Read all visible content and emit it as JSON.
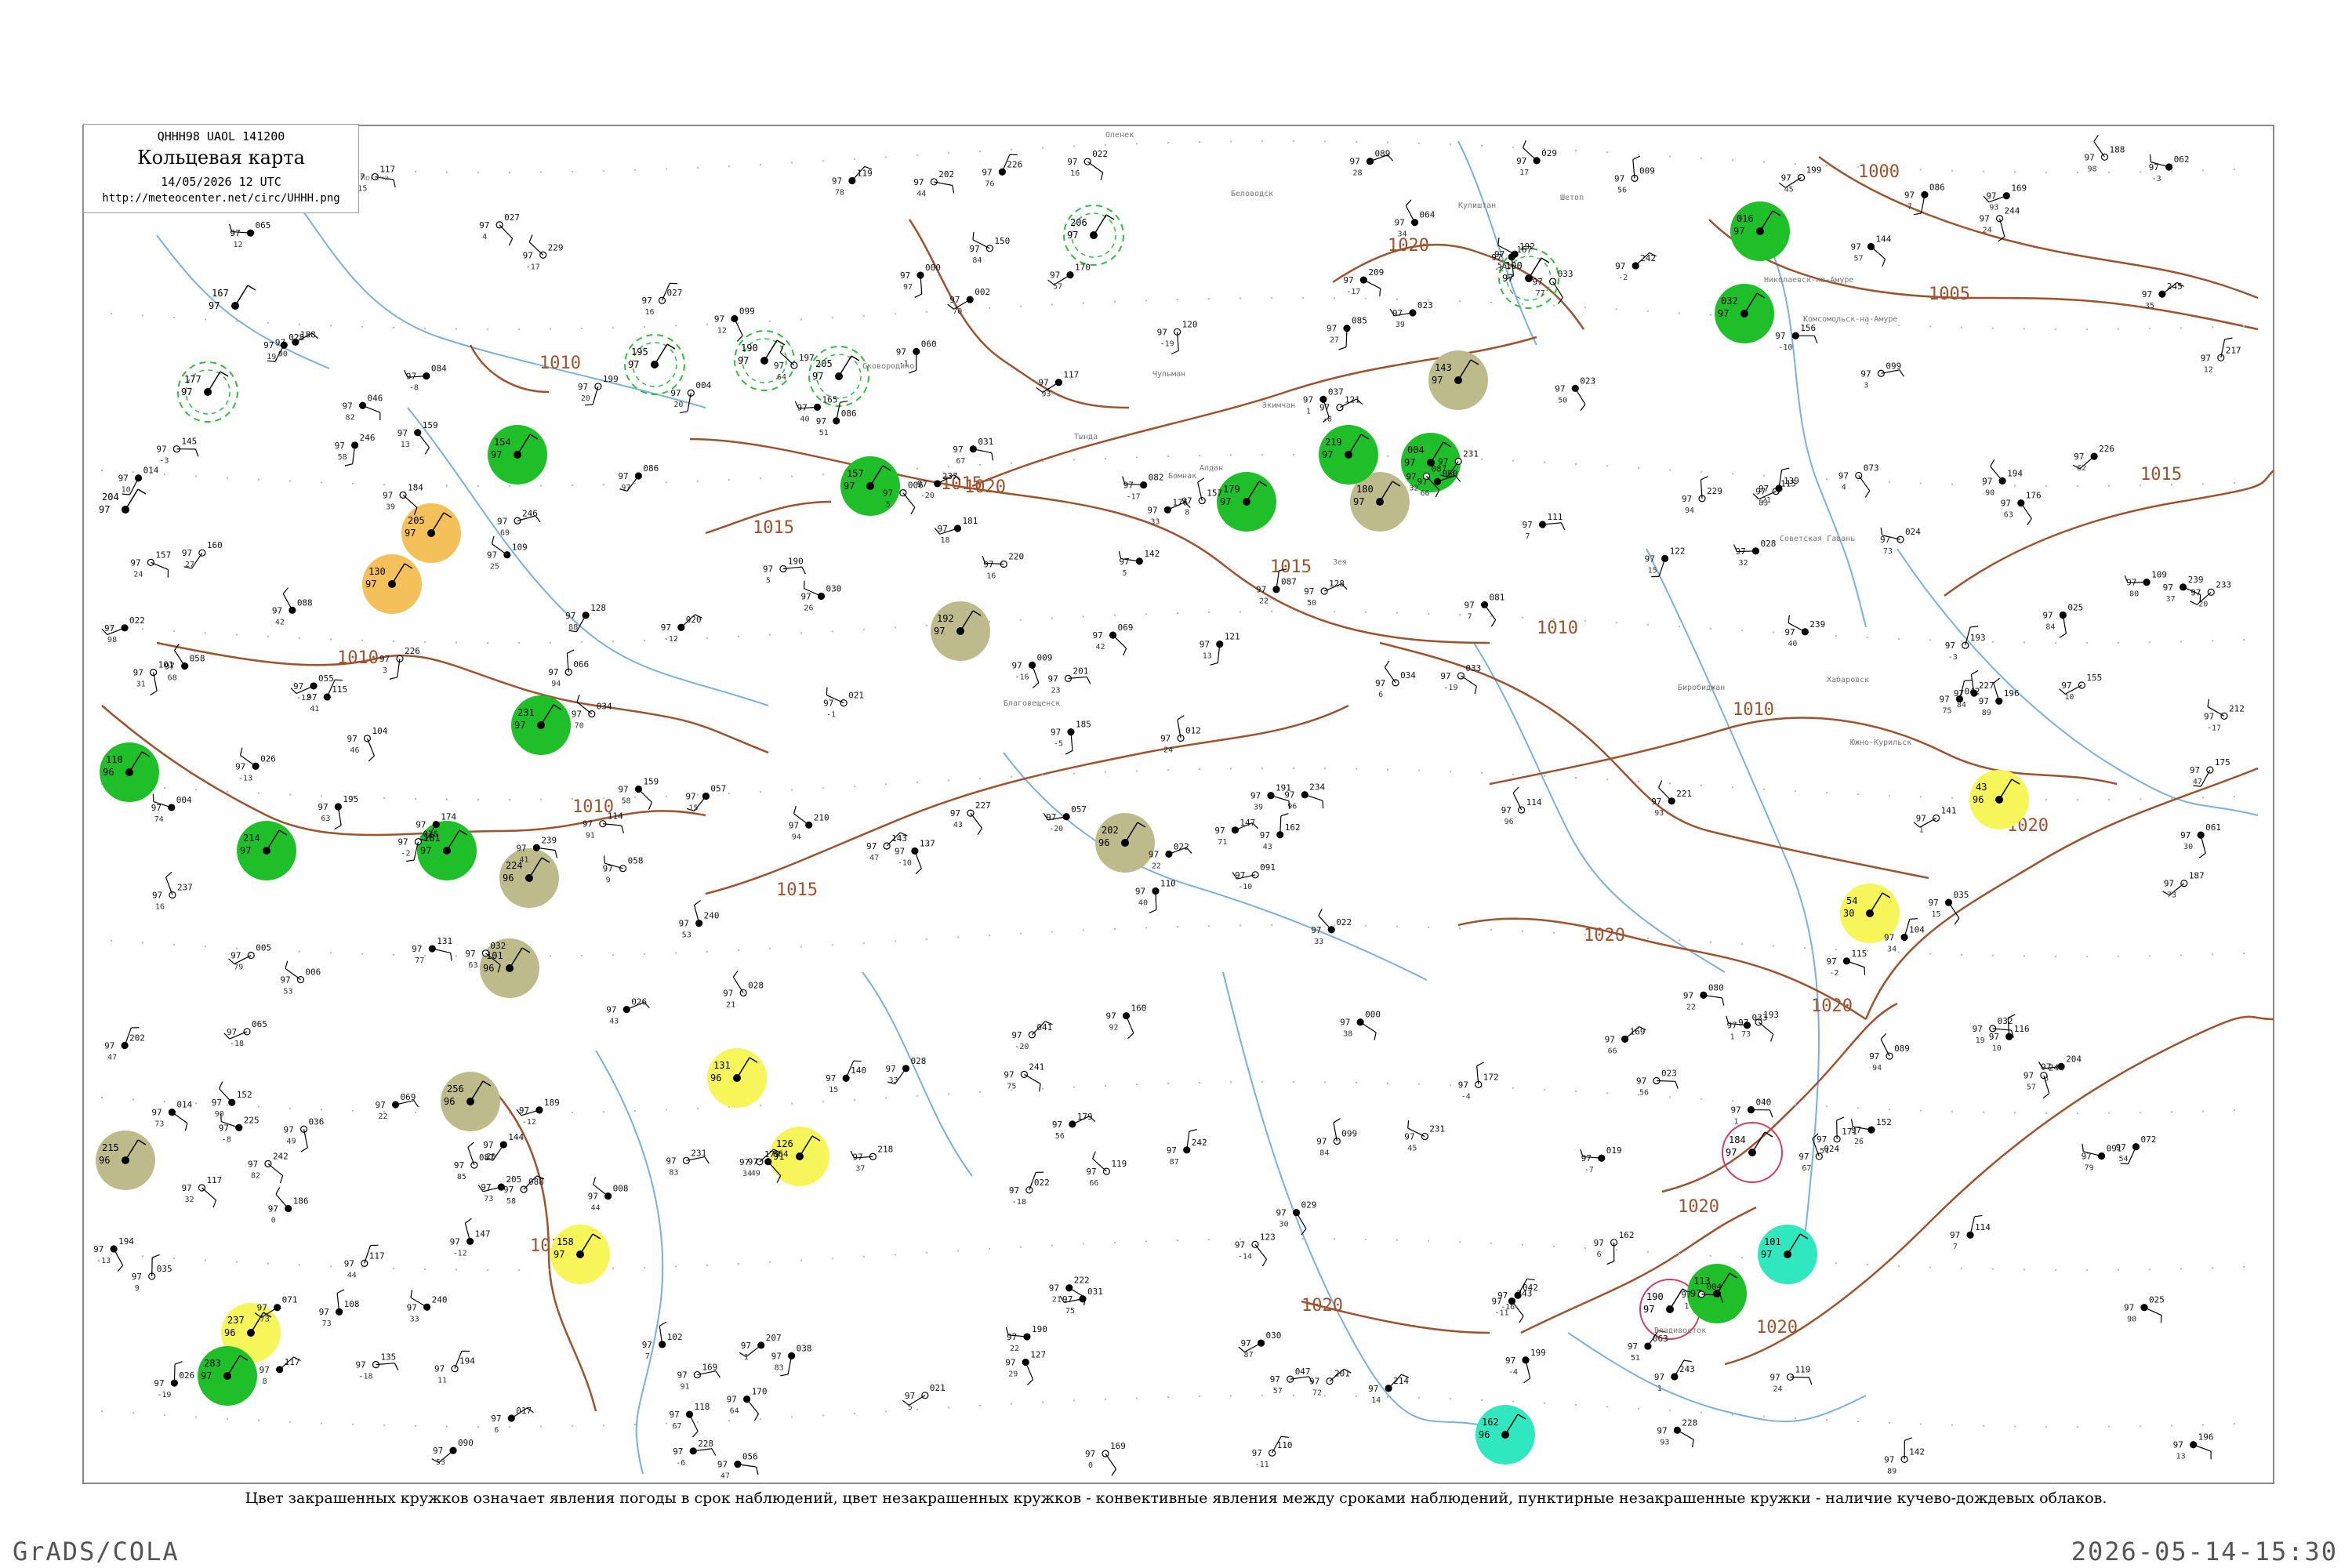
{
  "header": {
    "code": "QHHH98  UAOL  141200",
    "title": "Кольцевая карта",
    "date": "14/05/2026 12 UTC",
    "url": "http://meteocenter.net/circ/UHHH.png"
  },
  "caption": "Цвет закрашенных кружков означает явления погоды в срок наблюдений, цвет незакрашенных кружков - конвективные явления между сроками наблюдений, пунктирные незакрашенные кружки - наличие кучево-дождевых облаков.",
  "footer": {
    "left": "GrADS/COLA",
    "right": "2026-05-14-15:30"
  },
  "colors": {
    "isobar": "#a0522d",
    "river": "#7ab0e0",
    "rain": "#1fbf2a",
    "fog": "#bdbb8c",
    "haze": "#f4c05a",
    "snow": "#f6f65a",
    "ice": "#30e8c0",
    "cb_dashed": "#2fbf3f",
    "thunder_ring": "#d23c5a"
  },
  "isobars": [
    {
      "label": "1000"
    },
    {
      "label": "1005"
    },
    {
      "label": "1010"
    },
    {
      "label": "1015"
    },
    {
      "label": "1020"
    }
  ],
  "stations": [
    {
      "label": "167",
      "value2": "97",
      "kind": "plain"
    },
    {
      "label": "177",
      "value2": "97",
      "kind": "cb"
    },
    {
      "label": "204",
      "value2": "97",
      "kind": "plain"
    },
    {
      "label": "205",
      "value2": "97",
      "kind": "haze"
    },
    {
      "label": "130",
      "value2": "97",
      "kind": "haze"
    },
    {
      "label": "154",
      "value2": "97",
      "kind": "rain"
    },
    {
      "label": "231",
      "value2": "97",
      "kind": "rain"
    },
    {
      "label": "181",
      "value2": "97",
      "kind": "rain"
    },
    {
      "label": "214",
      "value2": "97",
      "kind": "rain"
    },
    {
      "label": "190",
      "value2": "97",
      "kind": "cb"
    },
    {
      "label": "205",
      "value2": "97",
      "kind": "cb"
    },
    {
      "label": "195",
      "value2": "97",
      "kind": "cb"
    },
    {
      "label": "192",
      "value2": "97",
      "kind": "fog"
    },
    {
      "label": "202",
      "value2": "96",
      "kind": "fog"
    },
    {
      "label": "224",
      "value2": "96",
      "kind": "fog"
    },
    {
      "label": "101",
      "value2": "96",
      "kind": "fog"
    },
    {
      "label": "256",
      "value2": "96",
      "kind": "fog"
    },
    {
      "label": "215",
      "value2": "96",
      "kind": "fog"
    },
    {
      "label": "131",
      "value2": "96",
      "kind": "snow"
    },
    {
      "label": "126",
      "value2": "91",
      "kind": "snow"
    },
    {
      "label": "158",
      "value2": "97",
      "kind": "snow"
    },
    {
      "label": "237",
      "value2": "96",
      "kind": "snow"
    },
    {
      "label": "54",
      "value2": "30",
      "kind": "snow"
    },
    {
      "label": "43",
      "value2": "96",
      "kind": "snow"
    },
    {
      "label": "143",
      "value2": "97",
      "kind": "fog"
    },
    {
      "label": "180",
      "value2": "97",
      "kind": "fog"
    },
    {
      "label": "206",
      "value2": "97",
      "kind": "cb"
    },
    {
      "label": "179",
      "value2": "97",
      "kind": "rain"
    },
    {
      "label": "219",
      "value2": "97",
      "kind": "rain"
    },
    {
      "label": "004",
      "value2": "97",
      "kind": "rain"
    },
    {
      "label": "100",
      "value2": "97",
      "kind": "cb"
    },
    {
      "label": "016",
      "value2": "97",
      "kind": "rain"
    },
    {
      "label": "032",
      "value2": "97",
      "kind": "rain"
    },
    {
      "label": "190",
      "value2": "97",
      "kind": "thunder"
    },
    {
      "label": "184",
      "value2": "97",
      "kind": "thunder"
    },
    {
      "label": "101",
      "value2": "97",
      "kind": "ice"
    },
    {
      "label": "162",
      "value2": "96",
      "kind": "ice"
    },
    {
      "label": "113",
      "value2": "97",
      "kind": "rain"
    },
    {
      "label": "110",
      "value2": "96",
      "kind": "rain"
    },
    {
      "label": "157",
      "value2": "97",
      "kind": "rain"
    },
    {
      "label": "283",
      "value2": "97",
      "kind": "rain"
    }
  ],
  "place_names": [
    "Шетоп",
    "Кулиштан",
    "Беловодск",
    "Оленек",
    "Алдан",
    "Чульман",
    "Тында",
    "Сковородино",
    "Благовещенск",
    "Хабаровск",
    "Николаевск-на-Амуре",
    "Комсомольск-на-Амуре",
    "Южно-Курильск",
    "Владивосток",
    "Советская Гавань",
    "Биробиджан",
    "Экимчан",
    "Бомнак",
    "Зея",
    "Могоча"
  ]
}
